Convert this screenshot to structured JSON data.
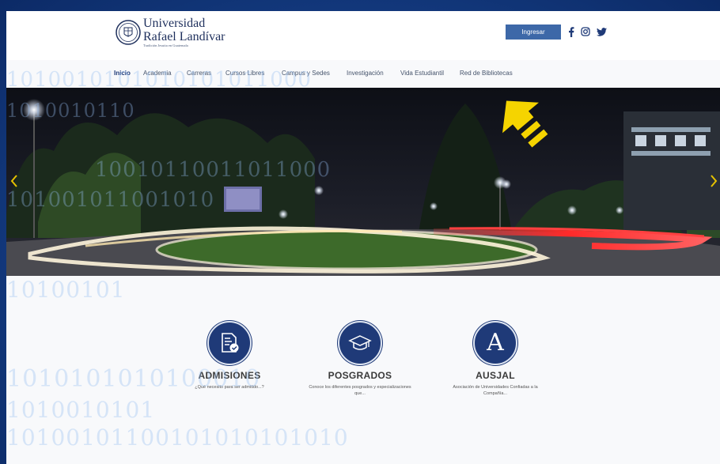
{
  "header": {
    "logo_line1": "Universidad",
    "logo_line2": "Rafael Landívar",
    "logo_tagline": "Tradición Jesuita en Guatemala",
    "login_label": "Ingresar",
    "social_icons": [
      "facebook-icon",
      "instagram-icon",
      "twitter-icon"
    ]
  },
  "nav": {
    "items": [
      {
        "label": "Inicio",
        "active": true
      },
      {
        "label": "Academia"
      },
      {
        "label": "Carreras"
      },
      {
        "label": "Cursos Libres"
      },
      {
        "label": "Campus y Sedes"
      },
      {
        "label": "Investigación"
      },
      {
        "label": "Vida Estudiantil"
      },
      {
        "label": "Red de Bibliotecas"
      }
    ]
  },
  "hero": {
    "image": "Night photo of a campus roundabout with light trails",
    "annotation": "yellow-arrow pointing at Red de Bibliotecas"
  },
  "cards": [
    {
      "icon": "document-check-icon",
      "title": "ADMISIONES",
      "description": "¿Qué necesito para ser admitido...?"
    },
    {
      "icon": "graduation-cap-icon",
      "title": "POSGRADOS",
      "description": "Conoce los diferentes posgrados y especializaciones que..."
    },
    {
      "icon": "letter-a-icon",
      "title": "AUSJAL",
      "description": "Asociación de Universidades Confiadas a la Compañía..."
    }
  ],
  "background_binary": [
    "1010010101010101011000",
    "1010010110",
    "10010110011011000",
    "101001011001010",
    "10100101",
    "1010101010100010",
    "1010010101",
    "10100101100101010101010"
  ],
  "colors": {
    "brand_navy": "#1f3a78",
    "button_blue": "#3d68a8",
    "annotation_yellow": "#f5d400",
    "outer_background": "#16418a"
  }
}
